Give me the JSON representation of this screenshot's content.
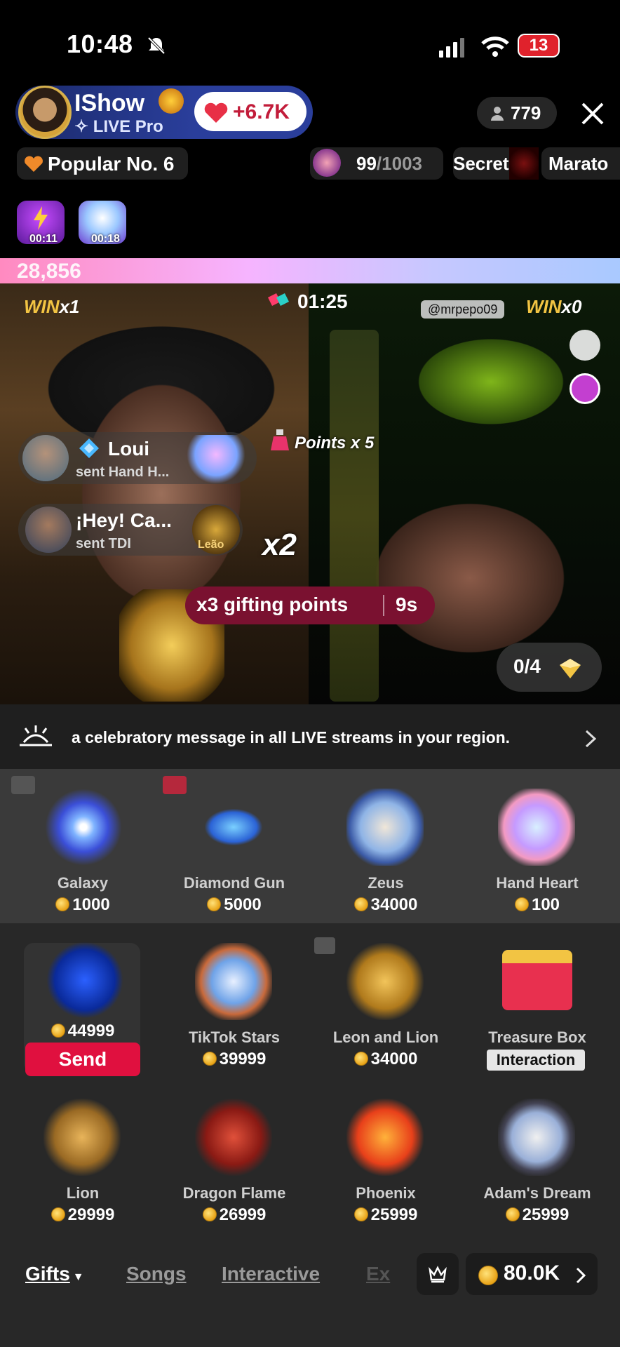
{
  "status_bar": {
    "time": "10:48",
    "battery": "13"
  },
  "host": {
    "name": "IShow",
    "badge": "LIVE Pro",
    "likes": "+6.7K"
  },
  "viewers": "779",
  "popular": {
    "label": "Popular No. 6"
  },
  "goal": {
    "current": "99",
    "total": "/1003"
  },
  "secret_label": "Secret",
  "marato_label": "Marato",
  "boosters": [
    {
      "time": "00:11"
    },
    {
      "time": "00:18"
    }
  ],
  "score": "28,856",
  "battle": {
    "timer": "01:25",
    "left": {
      "win_label": "WIN",
      "win_count": "x1"
    },
    "right": {
      "win_label": "WIN",
      "win_count": "x0",
      "handle": "@mrpepo09"
    },
    "points_label": "Points x 5",
    "multiplier": "x2",
    "gift_points": "x3 gifting points",
    "gift_points_time": "9s",
    "treasure_count": "0/4",
    "leao_label": "Leão"
  },
  "comments": [
    {
      "name": "Loui",
      "text": "sent Hand H..."
    },
    {
      "name": "¡Hey! Ca...",
      "text": "sent TDI"
    }
  ],
  "banner": {
    "text": "a celebratory message in all LIVE streams in your region."
  },
  "gifts": [
    {
      "name": "Galaxy",
      "price": "1000"
    },
    {
      "name": "Diamond Gun",
      "price": "5000"
    },
    {
      "name": "Zeus",
      "price": "34000"
    },
    {
      "name": "Hand Heart",
      "price": "100"
    },
    {
      "name": "",
      "price": "44999"
    },
    {
      "name": "TikTok Stars",
      "price": "39999"
    },
    {
      "name": "Leon and Lion",
      "price": "34000"
    },
    {
      "name": "Treasure Box",
      "price": ""
    },
    {
      "name": "Lion",
      "price": "29999"
    },
    {
      "name": "Dragon Flame",
      "price": "26999"
    },
    {
      "name": "Phoenix",
      "price": "25999"
    },
    {
      "name": "Adam's Dream",
      "price": "25999"
    }
  ],
  "send_label": "Send",
  "interaction_label": "Interaction",
  "tabs": {
    "gifts": "Gifts",
    "songs": "Songs",
    "interactive": "Interactive",
    "ex": "Ex"
  },
  "balance": "80.0K",
  "colors": {
    "accent": "#e0103f",
    "gold": "#f2c443",
    "host_pill": "#2a3e9b"
  }
}
